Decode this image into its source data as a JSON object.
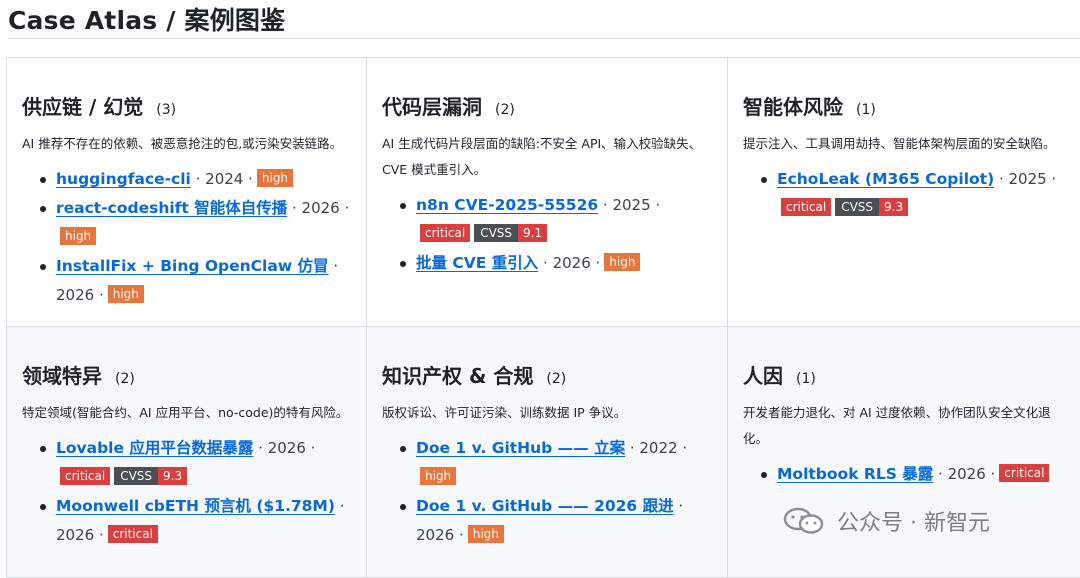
{
  "page": {
    "title": "Case Atlas / 案例图鉴"
  },
  "categories": [
    {
      "title": "供应链 / 幻觉",
      "count": "(3)",
      "desc": "AI 推荐不存在的依赖、被恶意抢注的包,或污染安装链路。",
      "cases": [
        {
          "name": "huggingface-cli",
          "meta": " · 2024 ·",
          "badge": "high"
        },
        {
          "name": "react-codeshift 智能体自传播",
          "meta": " · 2026 ·",
          "badge": "high"
        },
        {
          "name": "InstallFix + Bing OpenClaw 仿冒",
          "meta": " · 2026 ·",
          "badge": "high"
        }
      ]
    },
    {
      "title": "代码层漏洞",
      "count": "(2)",
      "desc": "AI 生成代码片段层面的缺陷:不安全 API、输入校验缺失、CVE 模式重引入。",
      "cases": [
        {
          "name": "n8n CVE-2025-55526",
          "meta": " · 2025 ·",
          "badge": "critical",
          "cvss_label": "CVSS",
          "cvss": "9.1"
        },
        {
          "name": "批量 CVE 重引入",
          "meta": " · 2026 ·",
          "badge": "high"
        }
      ]
    },
    {
      "title": "智能体风险",
      "count": "(1)",
      "desc": "提示注入、工具调用劫持、智能体架构层面的安全缺陷。",
      "cases": [
        {
          "name": "EchoLeak (M365 Copilot)",
          "meta": " · 2025 ·",
          "badge": "critical",
          "cvss_label": "CVSS",
          "cvss": "9.3"
        }
      ]
    },
    {
      "title": "领域特异",
      "count": "(2)",
      "desc": "特定领域(智能合约、AI 应用平台、no-code)的特有风险。",
      "cases": [
        {
          "name": "Lovable 应用平台数据暴露",
          "meta": " · 2026 ·",
          "badge": "critical",
          "cvss_label": "CVSS",
          "cvss": "9.3"
        },
        {
          "name": "Moonwell cbETH 预言机 ($1.78M)",
          "meta": " · 2026 ·",
          "badge": "critical"
        }
      ]
    },
    {
      "title": "知识产权 & 合规",
      "count": "(2)",
      "desc": "版权诉讼、许可证污染、训练数据 IP 争议。",
      "cases": [
        {
          "name": "Doe 1 v. GitHub —— 立案",
          "meta": " · 2022 ·",
          "badge": "high"
        },
        {
          "name": "Doe 1 v. GitHub —— 2026 跟进",
          "meta": " · 2026 ·",
          "badge": "high"
        }
      ]
    },
    {
      "title": "人因",
      "count": "(1)",
      "desc": "开发者能力退化、对 AI 过度依赖、协作团队安全文化退化。",
      "cases": [
        {
          "name": "Moltbook RLS 暴露",
          "meta": " · 2026 ·",
          "badge": "critical"
        }
      ]
    }
  ],
  "watermark": {
    "text": "公众号 · 新智元",
    "icon": "wechat-icon"
  }
}
